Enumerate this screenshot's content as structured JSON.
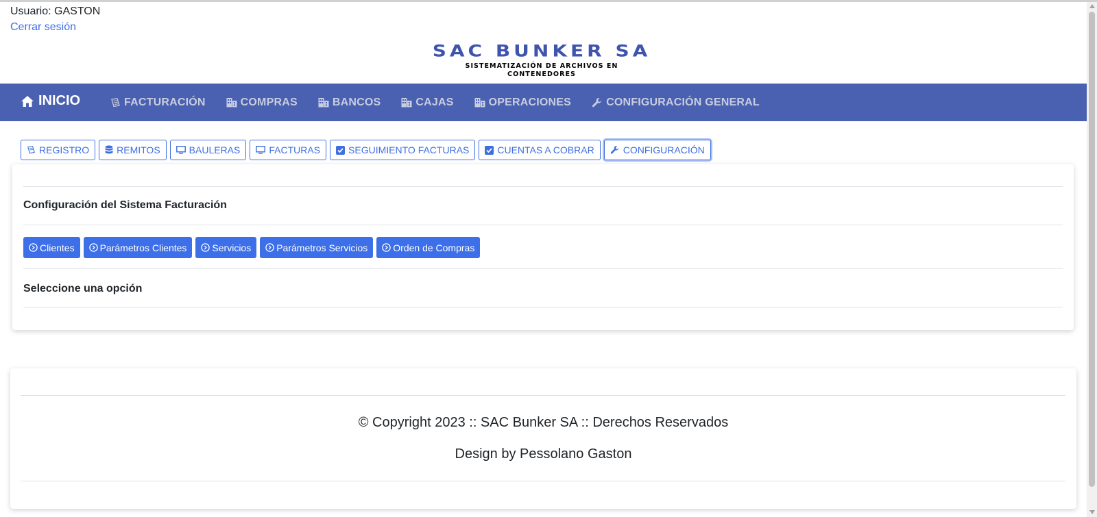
{
  "user": {
    "label": "Usuario: GASTON",
    "logout": "Cerrar sesión"
  },
  "logo": {
    "main": "SAC BUNKER SA",
    "sub": "SISTEMATIZACIÓN DE ARCHIVOS EN CONTENEDORES",
    "color": "#3f55ad"
  },
  "nav": {
    "home": "INICIO",
    "items": [
      {
        "label": "FACTURACIÓN",
        "icon": "receipt-icon"
      },
      {
        "label": "COMPRAS",
        "icon": "building-icon"
      },
      {
        "label": "BANCOS",
        "icon": "building-icon"
      },
      {
        "label": "CAJAS",
        "icon": "building-icon"
      },
      {
        "label": "OPERACIONES",
        "icon": "building-icon"
      },
      {
        "label": "CONFIGURACIÓN GENERAL",
        "icon": "wrench-icon"
      }
    ],
    "bg_color": "#4a60b0"
  },
  "subtabs": [
    {
      "label": "REGISTRO",
      "icon": "receipt-icon"
    },
    {
      "label": "REMITOS",
      "icon": "database-icon"
    },
    {
      "label": "BAULERAS",
      "icon": "monitor-icon"
    },
    {
      "label": "FACTURAS",
      "icon": "monitor-icon"
    },
    {
      "label": "SEGUIMIENTO FACTURAS",
      "icon": "checkbox-icon"
    },
    {
      "label": "CUENTAS A COBRAR",
      "icon": "checkbox-icon"
    },
    {
      "label": "CONFIGURACIÓN",
      "icon": "wrench-icon",
      "active": true
    }
  ],
  "config": {
    "title": "Configuración del Sistema Facturación",
    "buttons": [
      {
        "label": "Clientes",
        "icon": "circle-chevron-icon"
      },
      {
        "label": "Parámetros Clientes",
        "icon": "circle-chevron-icon"
      },
      {
        "label": "Servicios",
        "icon": "circle-chevron-icon"
      },
      {
        "label": "Parámetros Servicios",
        "icon": "circle-chevron-icon"
      },
      {
        "label": " Orden de Compras",
        "icon": "circle-chevron-icon"
      }
    ],
    "select_message": "Seleccione una opción"
  },
  "footer": {
    "copyright": "© Copyright 2023 :: SAC Bunker SA :: Derechos Reservados",
    "design": "Design by Pessolano Gaston"
  },
  "colors": {
    "primary": "#3d6fe8",
    "link": "#3d6fe0"
  }
}
